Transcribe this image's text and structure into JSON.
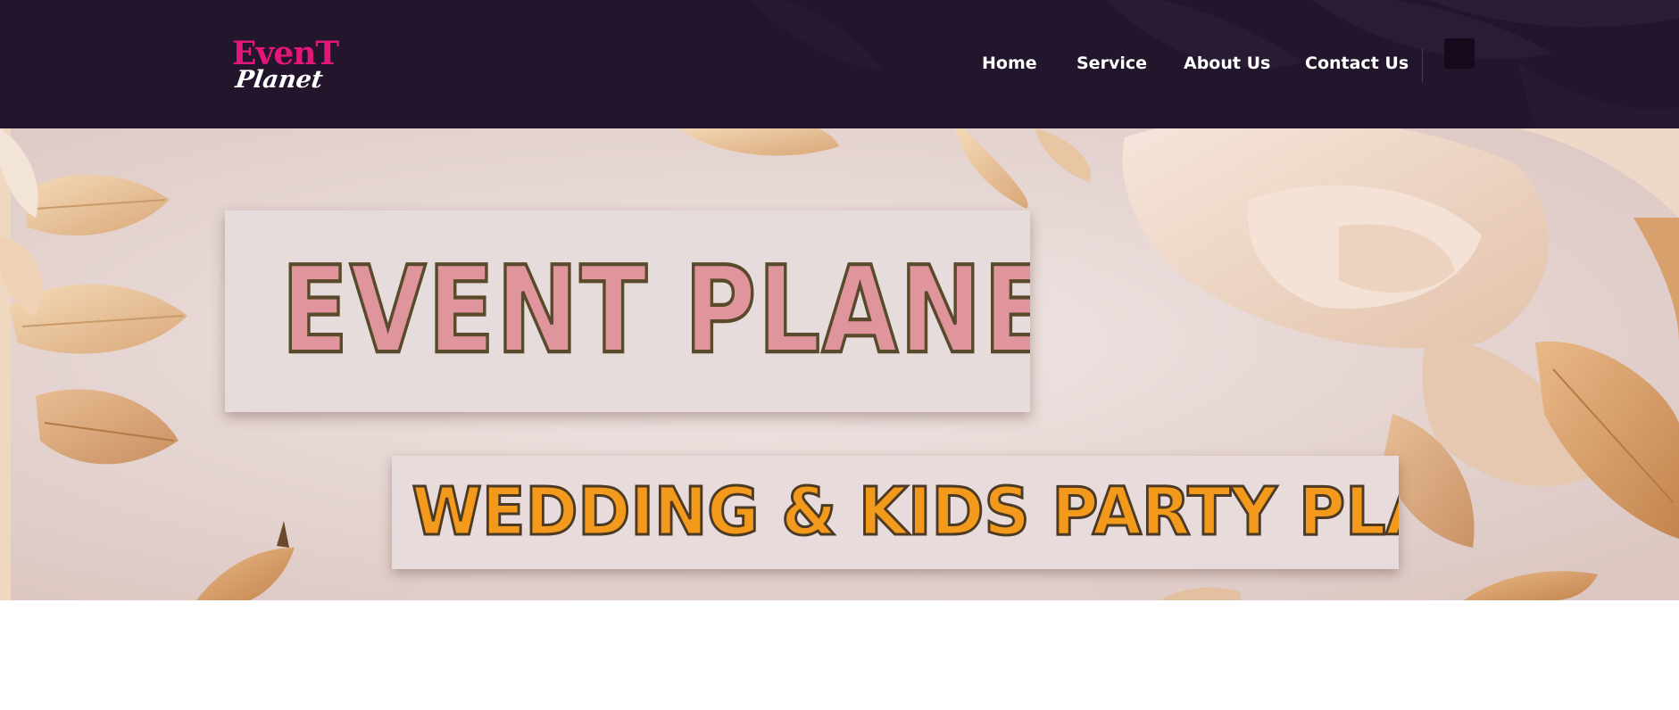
{
  "brand": {
    "logo_top": "EvenT",
    "logo_bottom": "Planet",
    "logo_color": "#e5167a"
  },
  "nav": {
    "items": [
      {
        "label": "Home"
      },
      {
        "label": "Service"
      },
      {
        "label": "About Us"
      },
      {
        "label": "Contact Us"
      }
    ]
  },
  "header": {
    "background": "#22152c",
    "menu_square_icon": "square-button-icon"
  },
  "hero": {
    "title": "EVENT PLANET",
    "subtitle": "WEDDING & KIDS PARTY PLANNER",
    "title_color": "#e0949c",
    "subtitle_color": "#f39a1c",
    "decoration": "paper-flowers-and-leaves"
  }
}
